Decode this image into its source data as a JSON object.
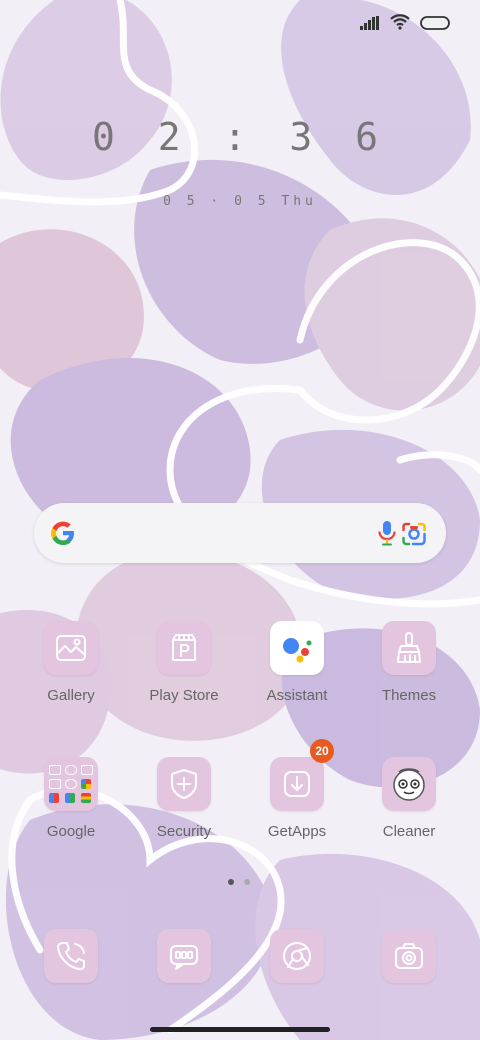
{
  "clock": {
    "time": "0 2 : 3 6",
    "date": "0 5 · 0 5  Thu"
  },
  "status": {
    "icons": [
      "signal-icon",
      "wifi-icon",
      "battery-icon"
    ]
  },
  "search": {
    "icons": [
      "google-g-icon",
      "microphone-icon",
      "google-lens-icon"
    ]
  },
  "apps_row1": [
    {
      "label": "Gallery"
    },
    {
      "label": "Play Store"
    },
    {
      "label": "Assistant"
    },
    {
      "label": "Themes"
    }
  ],
  "apps_row2": [
    {
      "label": "Google"
    },
    {
      "label": "Security"
    },
    {
      "label": "GetApps",
      "badge": "20"
    },
    {
      "label": "Cleaner"
    }
  ],
  "dock": [
    "phone-icon",
    "messages-icon",
    "browser-icon",
    "camera-icon"
  ],
  "pages": {
    "count": 2,
    "active": 1
  },
  "colors": {
    "icon_bg": "#e4c5e0",
    "badge": "#e85a1f"
  }
}
